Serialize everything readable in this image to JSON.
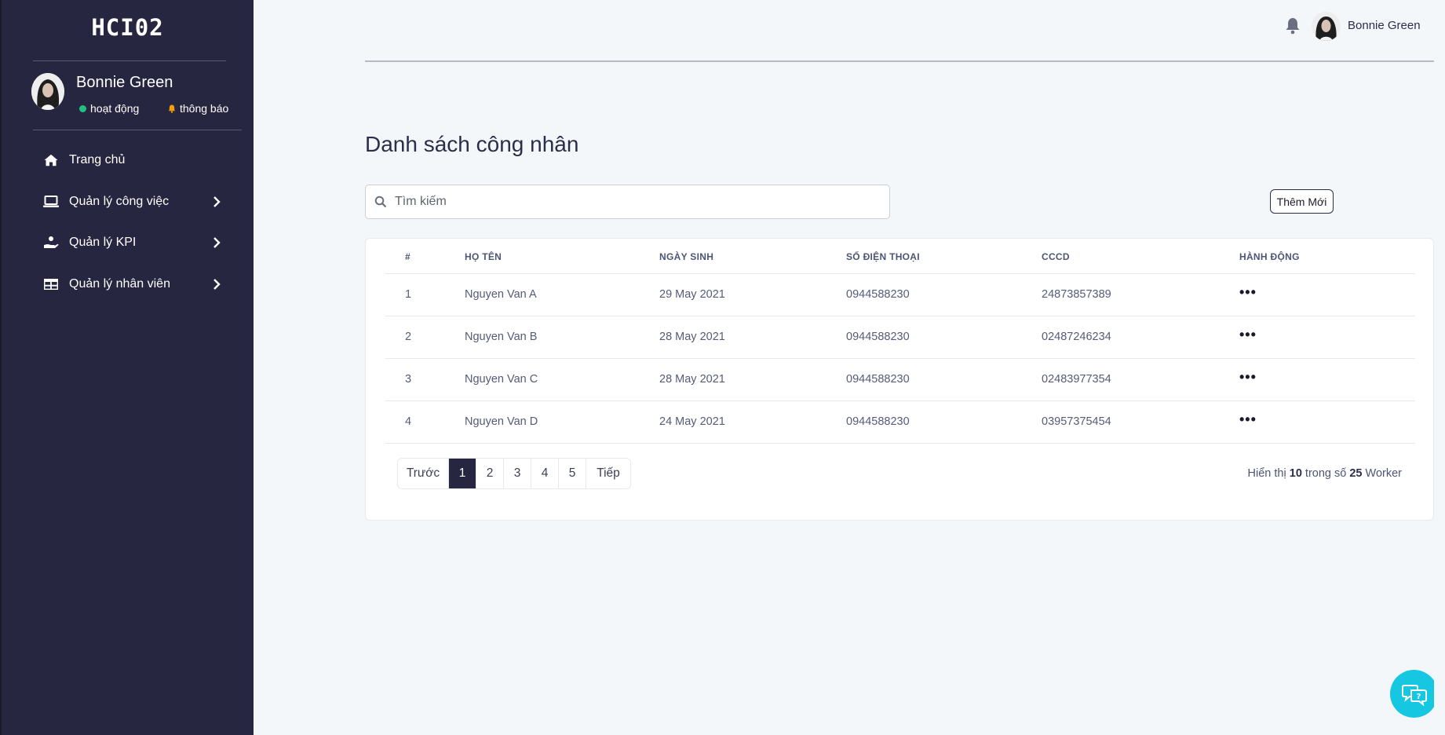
{
  "sidebar": {
    "logo": "HCI02",
    "profile": {
      "name": "Bonnie Green",
      "status_active": "hoạt động",
      "status_notify": "thông báo"
    },
    "items": [
      {
        "label": "Trang chủ",
        "icon": "home-icon"
      },
      {
        "label": "Quản lý công việc",
        "icon": "laptop-icon"
      },
      {
        "label": "Quản lý KPI",
        "icon": "hand-coin-icon"
      },
      {
        "label": "Quản lý nhân viên",
        "icon": "table-icon"
      }
    ]
  },
  "topbar": {
    "user_name": "Bonnie Green"
  },
  "main": {
    "title": "Danh sách công nhân",
    "search_placeholder": "Tìm kiếm",
    "add_button": "Thêm Mới",
    "table": {
      "headers": [
        "#",
        "HỌ TÊN",
        "NGÀY SINH",
        "SỐ ĐIỆN THOẠI",
        "CCCD",
        "HÀNH ĐỘNG"
      ],
      "rows": [
        {
          "no": "1",
          "name": "Nguyen Van A",
          "dob": "29 May 2021",
          "phone": "0944588230",
          "cccd": "24873857389",
          "action": "•••"
        },
        {
          "no": "2",
          "name": "Nguyen Van B",
          "dob": "28 May 2021",
          "phone": "0944588230",
          "cccd": "02487246234",
          "action": "•••"
        },
        {
          "no": "3",
          "name": "Nguyen Van C",
          "dob": "28 May 2021",
          "phone": "0944588230",
          "cccd": "02483977354",
          "action": "•••"
        },
        {
          "no": "4",
          "name": "Nguyen Van D",
          "dob": "24 May 2021",
          "phone": "0944588230",
          "cccd": "03957375454",
          "action": "•••"
        }
      ]
    },
    "pagination": {
      "prev": "Trước",
      "pages": [
        "1",
        "2",
        "3",
        "4",
        "5"
      ],
      "current": "1",
      "next": "Tiếp"
    },
    "summary": {
      "prefix": "Hiển thị",
      "shown": "10",
      "middle": "trong số",
      "total": "25",
      "suffix": "Worker"
    }
  },
  "colors": {
    "sidebar_bg": "#272641",
    "active_page": "#272641",
    "chat_button": "#15c7e1",
    "status_online": "#1fc27f",
    "status_notify": "#f59e0b"
  }
}
